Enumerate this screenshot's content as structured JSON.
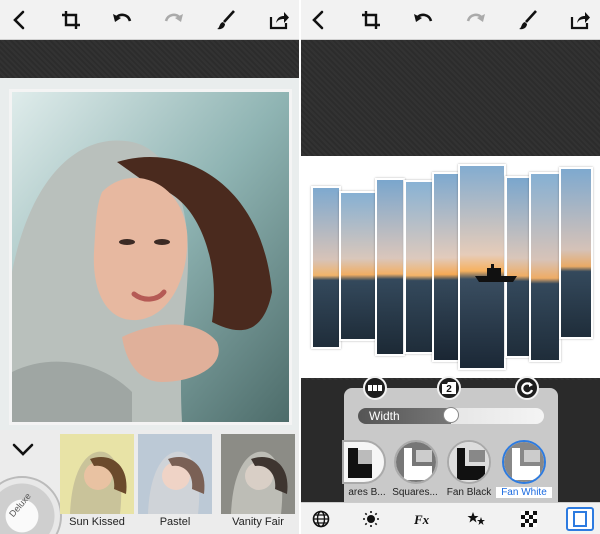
{
  "toolbar": {
    "icons": [
      "back-icon",
      "crop-icon",
      "undo-icon",
      "redo-icon",
      "brush-icon",
      "share-icon"
    ]
  },
  "left": {
    "filters": [
      {
        "label": "Sun Kissed"
      },
      {
        "label": "Pastel"
      },
      {
        "label": "Vanity Fair"
      }
    ],
    "dial_label": "Deluxe"
  },
  "right": {
    "panel_buttons": [
      {
        "icon": "layout-grid-icon"
      },
      {
        "icon": "count-badge-icon",
        "value": "2"
      },
      {
        "icon": "rotate-icon"
      }
    ],
    "slider": {
      "label": "Width",
      "value": 0.5
    },
    "styles": [
      {
        "label": "ares B...",
        "selected": false
      },
      {
        "label": "Squares...",
        "selected": false
      },
      {
        "label": "Fan Black",
        "selected": false
      },
      {
        "label": "Fan White",
        "selected": true
      }
    ],
    "bottom_icons": [
      "globe-icon",
      "brightness-icon",
      "fx-icon",
      "stars-icon",
      "checker-icon",
      "frame-icon"
    ]
  },
  "colors": {
    "accent": "#2d7be0",
    "toolbar_bg": "#f2f2f2",
    "dark_bg": "#2b2b2b"
  }
}
